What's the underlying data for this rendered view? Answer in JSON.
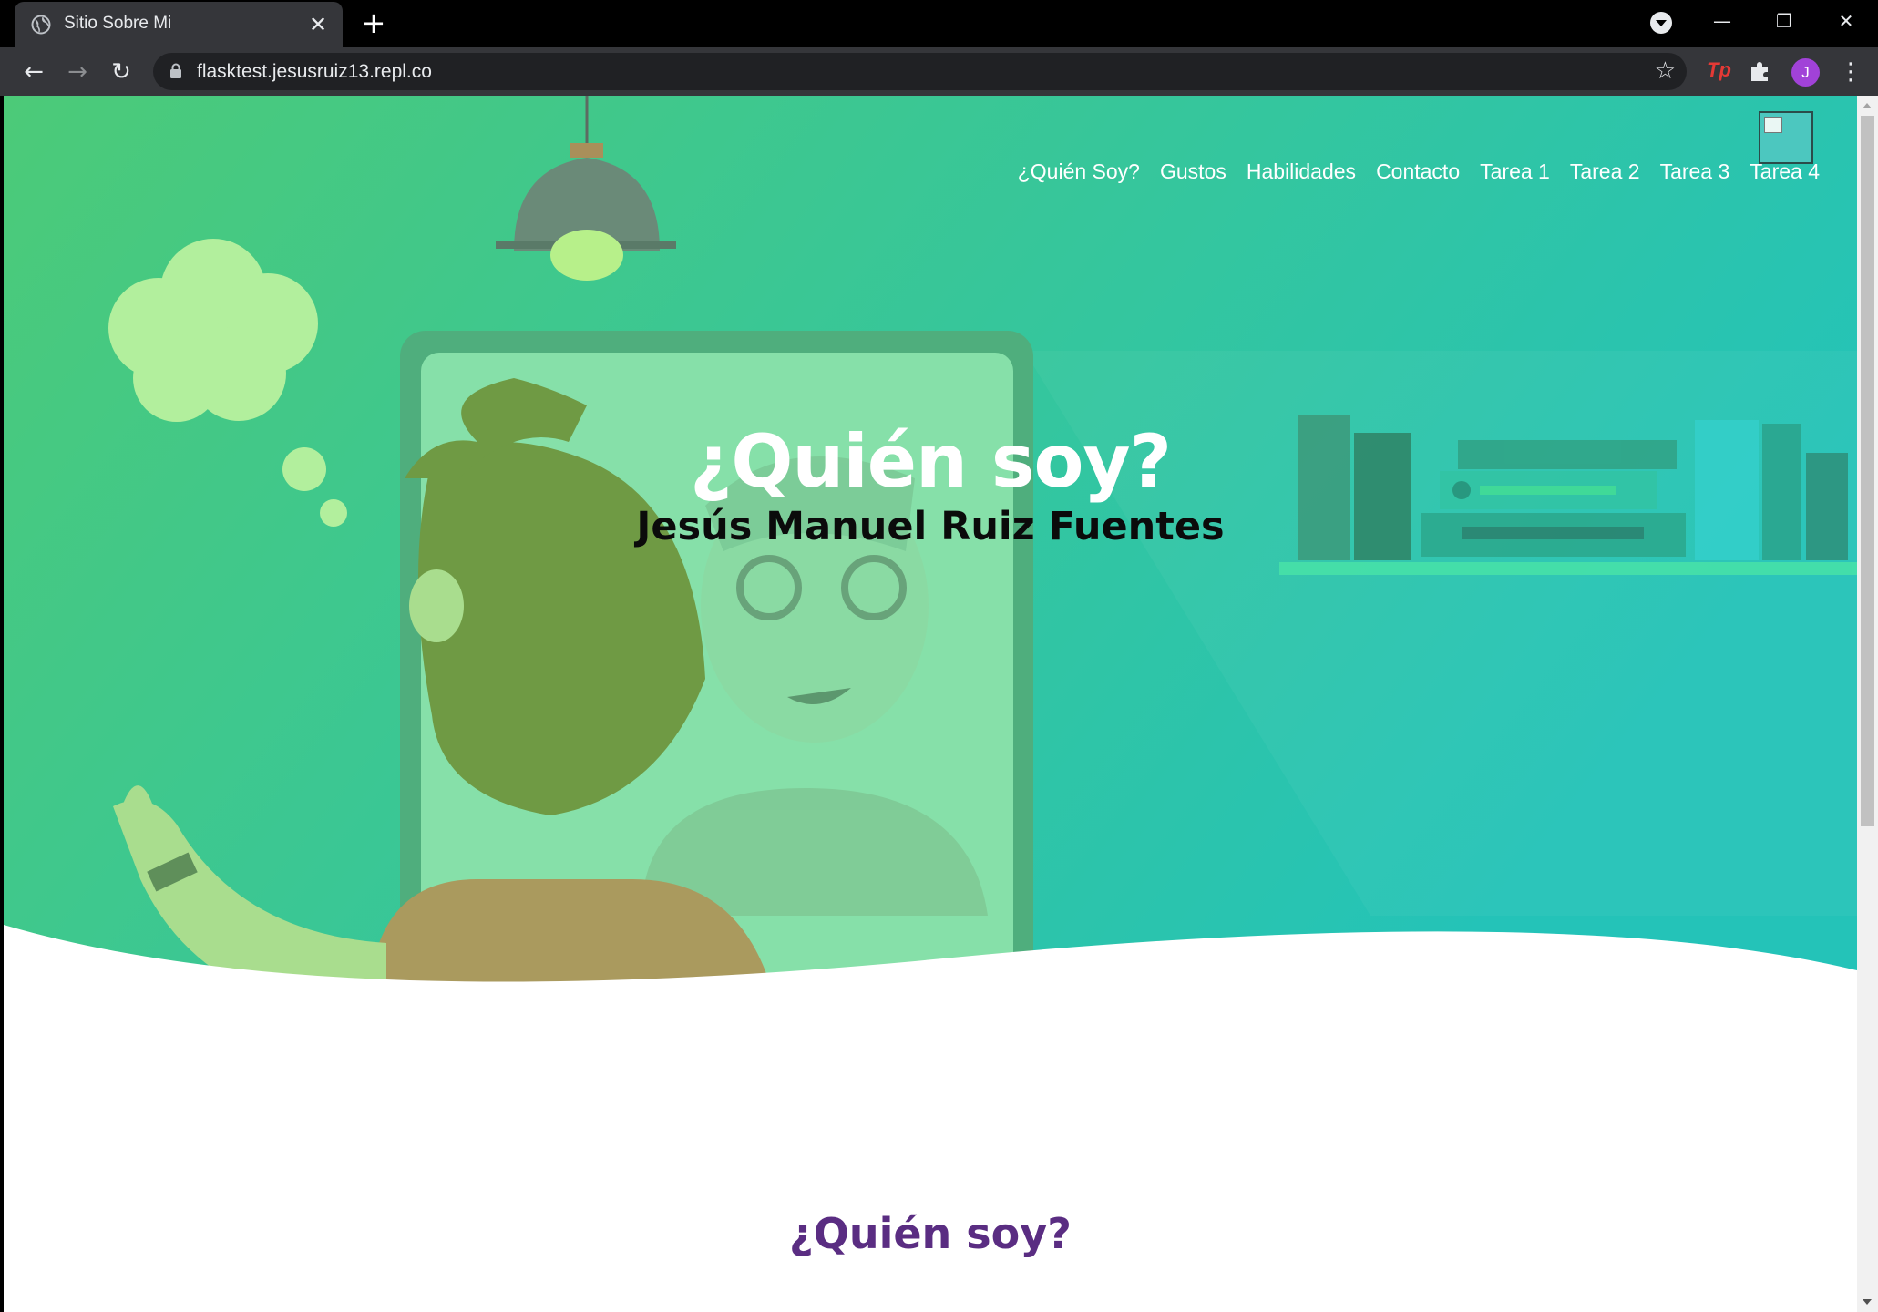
{
  "browser": {
    "tab_title": "Sitio Sobre Mi",
    "url": "flasktest.jesusruiz13.repl.co",
    "avatar_letter": "J",
    "extension_label": "Tp"
  },
  "nav": {
    "items": [
      "¿Quién Soy?",
      "Gustos",
      "Habilidades",
      "Contacto",
      "Tarea 1",
      "Tarea 2",
      "Tarea 3",
      "Tarea 4"
    ]
  },
  "hero": {
    "title": "¿Quién soy?",
    "subtitle": "Jesús Manuel Ruiz Fuentes"
  },
  "section": {
    "title": "¿Quién soy?"
  },
  "colors": {
    "hero_gradient_start": "#4cca78",
    "hero_gradient_end": "#24c3b8",
    "section_title": "#5a2d82",
    "accent_avatar": "#a142d8"
  }
}
